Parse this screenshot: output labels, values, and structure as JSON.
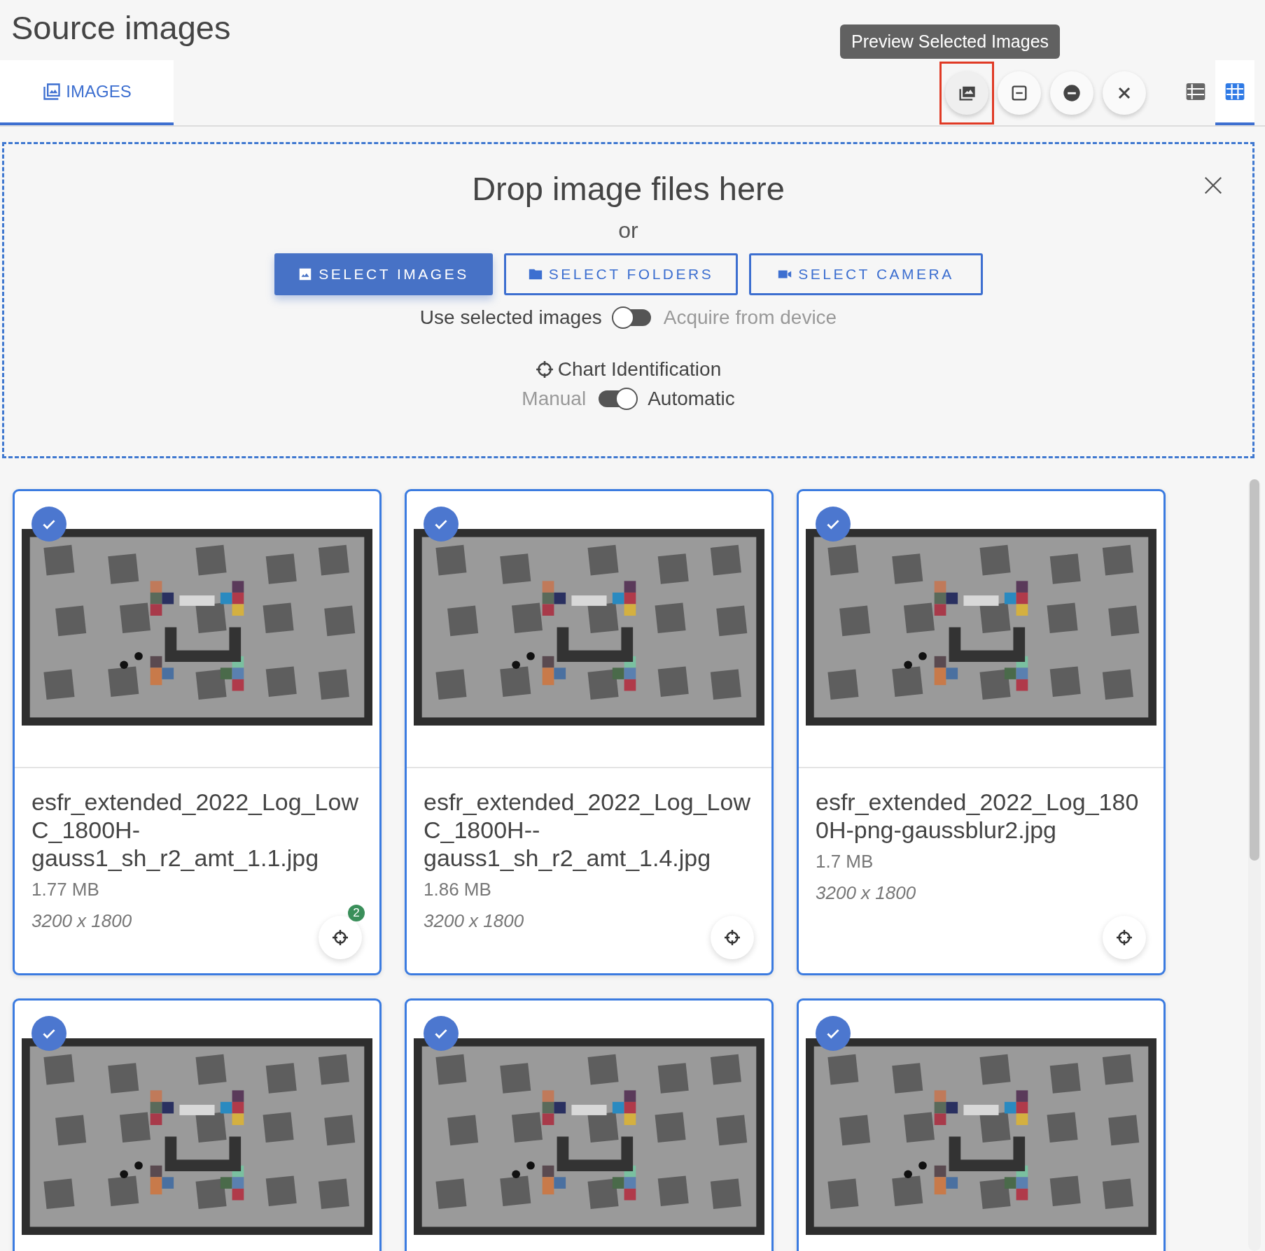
{
  "page_title": "Source images",
  "tabs": [
    {
      "label": "IMAGES",
      "selected": true
    }
  ],
  "tooltip": "Preview Selected Images",
  "toolbar": [
    {
      "kind": "preview",
      "highlighted": true
    },
    {
      "kind": "collapse",
      "highlighted": false
    },
    {
      "kind": "remove",
      "highlighted": false
    },
    {
      "kind": "clear",
      "highlighted": false
    }
  ],
  "view_toggles": [
    {
      "kind": "list",
      "selected": false
    },
    {
      "kind": "grid",
      "selected": true
    }
  ],
  "dropzone": {
    "heading": "Drop image files here",
    "or": "or",
    "buttons": [
      {
        "label": "SELECT IMAGES",
        "kind": "primary"
      },
      {
        "label": "SELECT FOLDERS",
        "kind": "outlined"
      },
      {
        "label": "SELECT CAMERA",
        "kind": "outlined"
      }
    ],
    "source_switch": {
      "left_label": "Use selected images",
      "right_label": "Acquire from device",
      "on": false
    },
    "chart_identification": {
      "title": "Chart Identification",
      "left_label": "Manual",
      "right_label": "Automatic",
      "on": true
    }
  },
  "cards": [
    {
      "filename": "esfr_extended_2022_Log_LowC_1800H-gauss1_sh_r2_amt_1.1.jpg",
      "size": "1.77 MB",
      "dimensions": "3200 x 1800",
      "selected": true,
      "badge": "2"
    },
    {
      "filename": "esfr_extended_2022_Log_LowC_1800H--gauss1_sh_r2_amt_1.4.jpg",
      "size": "1.86 MB",
      "dimensions": "3200 x 1800",
      "selected": true
    },
    {
      "filename": "esfr_extended_2022_Log_1800H-png-gaussblur2.jpg",
      "size": "1.7 MB",
      "dimensions": "3200 x 1800",
      "selected": true
    },
    {
      "selected": true
    },
    {
      "selected": true
    },
    {
      "selected": true
    }
  ]
}
